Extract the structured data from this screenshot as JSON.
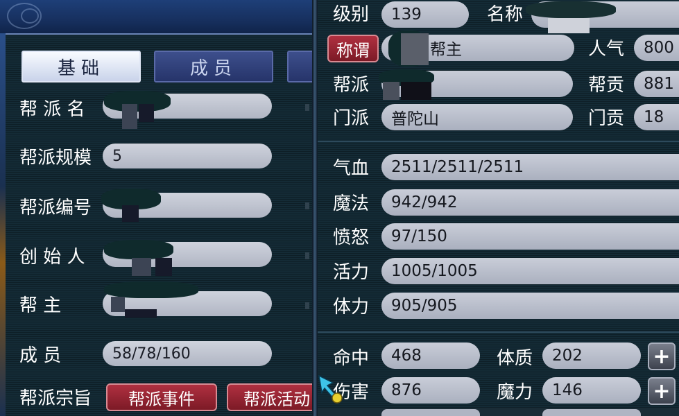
{
  "left": {
    "tabs": [
      {
        "label": "基础",
        "active": true
      },
      {
        "label": "成员",
        "active": false
      }
    ],
    "rows": [
      {
        "label": "帮 派 名",
        "value": ""
      },
      {
        "label": "帮派规模",
        "value": "5"
      },
      {
        "label": "帮派编号",
        "value": ""
      },
      {
        "label": "创 始 人",
        "value": ""
      },
      {
        "label": "帮      主",
        "value": ""
      },
      {
        "label": "成      员",
        "value": "58/78/160"
      }
    ],
    "purpose_label": "帮派宗旨",
    "buttons": {
      "events": "帮派事件",
      "activities": "帮派活动"
    }
  },
  "right": {
    "level_label": "级别",
    "level_value": "139",
    "name_label": "名称",
    "title_button": "称谓",
    "title_value": "帮主",
    "popularity_label": "人气",
    "popularity_value": "800",
    "faction_label": "帮派",
    "contribution_label": "帮贡",
    "contribution_value": "881",
    "sect_label": "门派",
    "sect_value": "普陀山",
    "sect_contribution_label": "门贡",
    "sect_contribution_value": "18",
    "stats": [
      {
        "label": "气血",
        "value": "2511/2511/2511"
      },
      {
        "label": "魔法",
        "value": "942/942"
      },
      {
        "label": "愤怒",
        "value": "97/150"
      },
      {
        "label": "活力",
        "value": "1005/1005"
      },
      {
        "label": "体力",
        "value": "905/905"
      }
    ],
    "attributes": [
      {
        "label": "命中",
        "value": "468",
        "attr_label": "体质",
        "attr_value": "202"
      },
      {
        "label": "伤害",
        "value": "876",
        "attr_label": "魔力",
        "attr_value": "146"
      }
    ],
    "plus_symbol": "+"
  },
  "colors": {
    "panel_bg": "#142b36",
    "header_blue": "#1e3f78",
    "field_gray": "#c9cdd8",
    "button_red": "#9a2434",
    "text_white": "#ffffff"
  }
}
